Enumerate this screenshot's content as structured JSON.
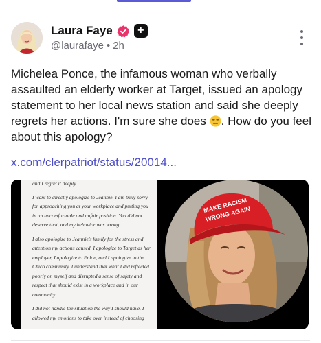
{
  "post": {
    "author": {
      "display_name": "Laura Faye",
      "handle": "@laurafaye",
      "separator": "•",
      "time_ago": "2h",
      "badge_icon": "verified-icon",
      "plus_badge": "+"
    },
    "text": "Michelea Ponce, the infamous woman who verbally assaulted an elderly worker at Target, issued an apology statement to her local news station and said she deeply regrets her actions. I'm sure she does",
    "text_tail": ". How do you feel about this apology?",
    "emoji": "unamused-face",
    "link": "x.com/clerpatriot/status/20014...",
    "media": {
      "document": {
        "paragraphs": [
          "and I regret it deeply.",
          "I want to directly apologize to Jeannie. I am truly sorry for approaching you at your workplace and putting you in an uncomfortable and unfair position. You did not deserve that, and my behavior was wrong.",
          "I also apologize to Jeannie's family for the stress and attention my actions caused. I apologize to Target as her employer, I apologize to Enloe, and I apologize to the Chico community. I understand that what I did reflected poorly on myself and disrupted a sense of safety and respect that should exist in a workplace and in our community.",
          "I did not handle the situation the way I should have. I allowed my emotions to take over instead of choosing"
        ]
      },
      "photo": {
        "hat_text_line1": "MAKE RACISM",
        "hat_text_line2": "WRONG AGAIN",
        "hat_color": "#d81f26"
      }
    }
  },
  "colors": {
    "accent": "#5b5bd6",
    "link": "#4d4dc7",
    "verified": "#e8336b",
    "muted": "#6b6b75"
  }
}
